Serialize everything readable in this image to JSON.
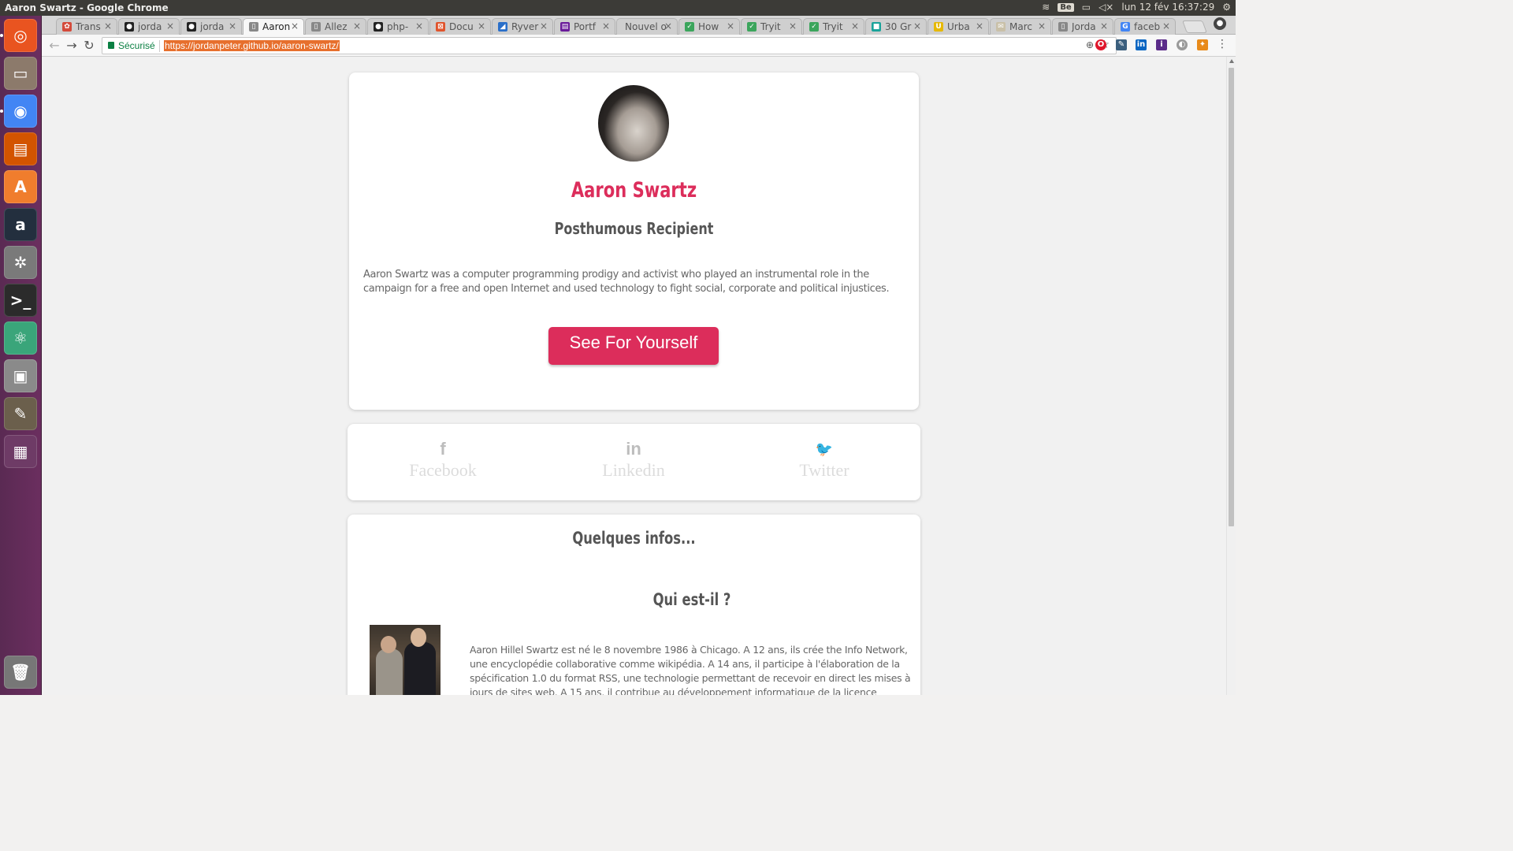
{
  "window": {
    "title": "Aaron Swartz - Google Chrome"
  },
  "system_tray": {
    "keyboard": "Be",
    "datetime": "lun 12 fév 16:37:29"
  },
  "launcher": [
    {
      "name": "ubuntu-dash-icon",
      "glyph": "◎",
      "color": "#e95420"
    },
    {
      "name": "files-icon",
      "glyph": "▭",
      "color": "#8c7a6b"
    },
    {
      "name": "chrome-icon",
      "glyph": "◉",
      "color": "#4285f4"
    },
    {
      "name": "impress-icon",
      "glyph": "▤",
      "color": "#d35400"
    },
    {
      "name": "software-center-icon",
      "glyph": "A",
      "color": "#f07d2d"
    },
    {
      "name": "amazon-icon",
      "glyph": "a",
      "color": "#232f3e"
    },
    {
      "name": "settings-icon",
      "glyph": "✲",
      "color": "#7a7a7a"
    },
    {
      "name": "terminal-icon",
      "glyph": ">_",
      "color": "#2b2b2b"
    },
    {
      "name": "atom-icon",
      "glyph": "⚛",
      "color": "#3aa57a"
    },
    {
      "name": "scanner-icon",
      "glyph": "▣",
      "color": "#8a8a8a"
    },
    {
      "name": "gimp-icon",
      "glyph": "✎",
      "color": "#6b5f4c"
    },
    {
      "name": "workspace-icon",
      "glyph": "▦",
      "color": "#6e3b66"
    }
  ],
  "tabs": [
    {
      "label": "Trans",
      "fav": "#d44a3a",
      "glyph": "✿"
    },
    {
      "label": "jorda",
      "fav": "#222222",
      "glyph": "●"
    },
    {
      "label": "jorda",
      "fav": "#222222",
      "glyph": "●"
    },
    {
      "label": "Aaron",
      "fav": "#888888",
      "glyph": "▯",
      "active": true
    },
    {
      "label": "Allez",
      "fav": "#888888",
      "glyph": "▯"
    },
    {
      "label": "php-",
      "fav": "#222222",
      "glyph": "●"
    },
    {
      "label": "Docu",
      "fav": "#e0542c",
      "glyph": "⊠"
    },
    {
      "label": "Ryver",
      "fav": "#2a6fc9",
      "glyph": "◢"
    },
    {
      "label": "Portf",
      "fav": "#6a1b9a",
      "glyph": "▤"
    },
    {
      "label": "Nouvel o",
      "fav": "",
      "glyph": ""
    },
    {
      "label": "How",
      "fav": "#3ba55c",
      "glyph": "✓"
    },
    {
      "label": "Tryit",
      "fav": "#3ba55c",
      "glyph": "✓"
    },
    {
      "label": "Tryit",
      "fav": "#3ba55c",
      "glyph": "✓"
    },
    {
      "label": "30 Gr",
      "fav": "#1aa39a",
      "glyph": "■"
    },
    {
      "label": "Urba",
      "fav": "#e6b800",
      "glyph": "U"
    },
    {
      "label": "Marc",
      "fav": "#c9c0a8",
      "glyph": "✉"
    },
    {
      "label": "Jorda",
      "fav": "#888888",
      "glyph": "▯"
    },
    {
      "label": "faceb",
      "fav": "#4285f4",
      "glyph": "G"
    }
  ],
  "omnibox": {
    "secure_label": "Sécurisé",
    "url": "https://jordanpeter.github.io/aaron-swartz/"
  },
  "profile": {
    "name": "Aaron Swartz",
    "role": "Posthumous Recipient",
    "bio": "Aaron Swartz was a computer programming prodigy and activist who played an instrumental role in the campaign for a free and open Internet and used technology to fight social, corporate and political injustices.",
    "cta": "See For Yourself"
  },
  "social": [
    {
      "label": "Facebook",
      "icon": "f"
    },
    {
      "label": "Linkedin",
      "icon": "in"
    },
    {
      "label": "Twitter",
      "icon": "🐦"
    }
  ],
  "info": {
    "title": "Quelques infos...",
    "subtitle": "Qui est-il ?",
    "text": "Aaron Hillel Swartz est né le 8 novembre 1986 à Chicago. A 12 ans, ils crée the Info Network, une encyclopédie collaborative comme wikipédia. A 14 ans, il participe à l'élaboration de la spécification 1.0 du format RSS, une technologie permettant de recevoir en direct les mises à jours de sites web. A 15 ans, il contribue au développement informatique de la licence Creative Commons, alternative aux"
  },
  "colors": {
    "accent": "#dc2d5b",
    "url_highlight": "#e76f2d",
    "secure_green": "#0b8043"
  }
}
